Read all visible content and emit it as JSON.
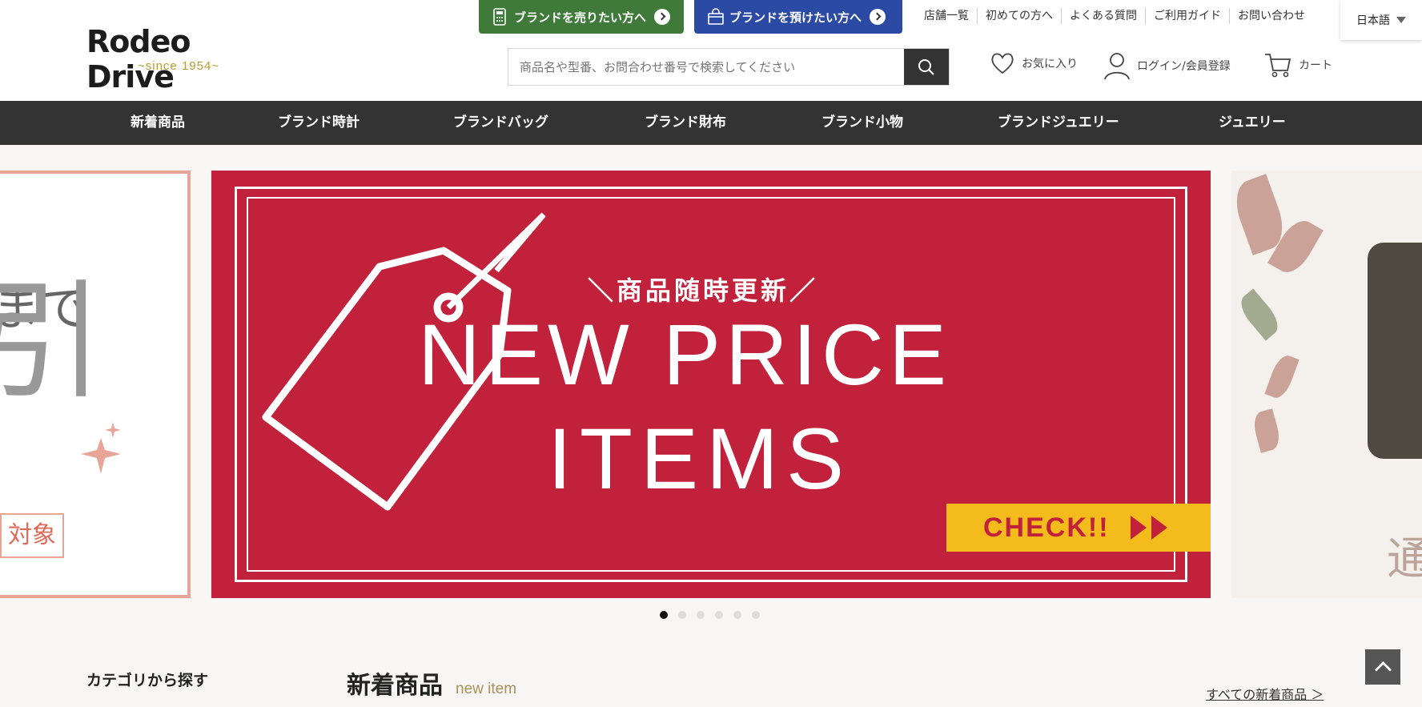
{
  "header": {
    "logo_text": "Rodeo Drive",
    "logo_tagline": "~since 1954~",
    "cta_sell": "ブランドを売りたい方へ",
    "cta_consign": "ブランドを預けたい方へ",
    "util_links": [
      "店舗一覧",
      "初めての方へ",
      "よくある質問",
      "ご利用ガイド",
      "お問い合わせ"
    ],
    "language": "日本語",
    "search_placeholder": "商品名や型番、お問合わせ番号で検索してください",
    "favorites": "お気に入り",
    "login": "ログイン/会員登録",
    "cart": "カート"
  },
  "nav": {
    "items": [
      "新着商品",
      "ブランド時計",
      "ブランドバッグ",
      "ブランド財布",
      "ブランド小物",
      "ブランドジュエリー",
      "ジュエリー"
    ]
  },
  "carousel": {
    "left_text_top": "まで",
    "left_text_big": "引",
    "left_tag": "対象",
    "main_subtitle": "＼商品随時更新／",
    "main_title_line1": "NEW PRICE",
    "main_title_line2": "ITEMS",
    "main_cta": "CHECK!!",
    "right_text": "通",
    "slide_count": 6,
    "active_slide": 1
  },
  "sections": {
    "category_title": "カテゴリから探す",
    "new_items_title": "新着商品",
    "new_items_en": "new item",
    "all_new_items_link": "すべての新着商品 ＞"
  },
  "colors": {
    "nav_bg": "#333333",
    "banner_red": "#c1213b",
    "check_yellow": "#f3bb1c",
    "sell_green": "#3f7a3a",
    "consign_blue": "#2b4aa3"
  }
}
